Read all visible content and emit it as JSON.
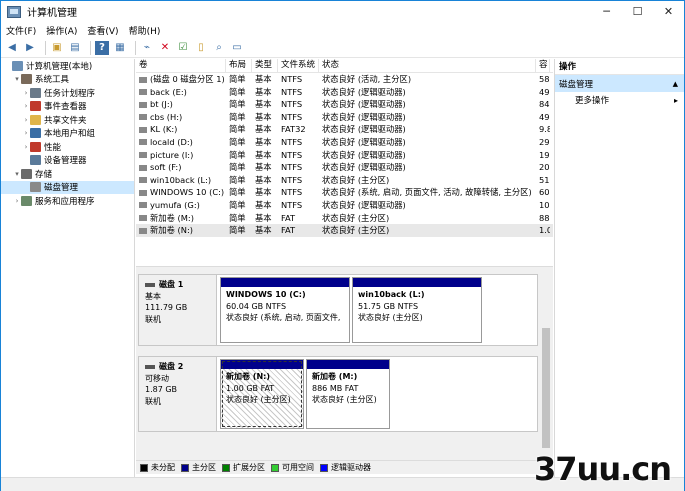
{
  "window": {
    "title": "计算机管理",
    "min": "─",
    "max": "☐",
    "close": "✕"
  },
  "menu": [
    "文件(F)",
    "操作(A)",
    "查看(V)",
    "帮助(H)"
  ],
  "tree": [
    {
      "label": "计算机管理(本地)",
      "indent": 0,
      "arrow": "",
      "color": "#6a8fb5"
    },
    {
      "label": "系统工具",
      "indent": 1,
      "arrow": "▾",
      "color": "#7a6a5a"
    },
    {
      "label": "任务计划程序",
      "indent": 2,
      "arrow": "›",
      "color": "#6a7a8a"
    },
    {
      "label": "事件查看器",
      "indent": 2,
      "arrow": "›",
      "color": "#c0392b"
    },
    {
      "label": "共享文件夹",
      "indent": 2,
      "arrow": "›",
      "color": "#e0b54a"
    },
    {
      "label": "本地用户和组",
      "indent": 2,
      "arrow": "›",
      "color": "#3a6ea5"
    },
    {
      "label": "性能",
      "indent": 2,
      "arrow": "›",
      "color": "#c0392b"
    },
    {
      "label": "设备管理器",
      "indent": 2,
      "arrow": "",
      "color": "#5a7a9a"
    },
    {
      "label": "存储",
      "indent": 1,
      "arrow": "▾",
      "color": "#6a6a6a"
    },
    {
      "label": "磁盘管理",
      "indent": 2,
      "arrow": "",
      "color": "#8a8a8a",
      "selected": true
    },
    {
      "label": "服务和应用程序",
      "indent": 1,
      "arrow": "›",
      "color": "#6a8a6a"
    }
  ],
  "columns": [
    "卷",
    "布局",
    "类型",
    "文件系统",
    "状态",
    "容"
  ],
  "volumes": [
    {
      "vol": "(磁盘 0 磁盘分区 1)",
      "layout": "简单",
      "type": "基本",
      "fs": "NTFS",
      "status": "状态良好 (活动, 主分区)",
      "cap": "58"
    },
    {
      "vol": "back (E:)",
      "layout": "简单",
      "type": "基本",
      "fs": "NTFS",
      "status": "状态良好 (逻辑驱动器)",
      "cap": "49"
    },
    {
      "vol": "bt (J:)",
      "layout": "简单",
      "type": "基本",
      "fs": "NTFS",
      "status": "状态良好 (逻辑驱动器)",
      "cap": "84"
    },
    {
      "vol": "cbs (H:)",
      "layout": "简单",
      "type": "基本",
      "fs": "NTFS",
      "status": "状态良好 (逻辑驱动器)",
      "cap": "49"
    },
    {
      "vol": "KL (K:)",
      "layout": "简单",
      "type": "基本",
      "fs": "FAT32",
      "status": "状态良好 (逻辑驱动器)",
      "cap": "9.8"
    },
    {
      "vol": "locald (D:)",
      "layout": "简单",
      "type": "基本",
      "fs": "NTFS",
      "status": "状态良好 (逻辑驱动器)",
      "cap": "29"
    },
    {
      "vol": "picture (I:)",
      "layout": "简单",
      "type": "基本",
      "fs": "NTFS",
      "status": "状态良好 (逻辑驱动器)",
      "cap": "19"
    },
    {
      "vol": "soft (F:)",
      "layout": "简单",
      "type": "基本",
      "fs": "NTFS",
      "status": "状态良好 (逻辑驱动器)",
      "cap": "20"
    },
    {
      "vol": "win10back (L:)",
      "layout": "简单",
      "type": "基本",
      "fs": "NTFS",
      "status": "状态良好 (主分区)",
      "cap": "51"
    },
    {
      "vol": "WINDOWS 10 (C:)",
      "layout": "简单",
      "type": "基本",
      "fs": "NTFS",
      "status": "状态良好 (系统, 启动, 页面文件, 活动, 故障转储, 主分区)",
      "cap": "60"
    },
    {
      "vol": "yumufa (G:)",
      "layout": "简单",
      "type": "基本",
      "fs": "NTFS",
      "status": "状态良好 (逻辑驱动器)",
      "cap": "10"
    },
    {
      "vol": "新加卷 (M:)",
      "layout": "简单",
      "type": "基本",
      "fs": "FAT",
      "status": "状态良好 (主分区)",
      "cap": "88"
    },
    {
      "vol": "新加卷 (N:)",
      "layout": "简单",
      "type": "基本",
      "fs": "FAT",
      "status": "状态良好 (主分区)",
      "cap": "1.0",
      "selected": true
    }
  ],
  "disks": [
    {
      "name": "磁盘 1",
      "kind": "基本",
      "size": "111.79 GB",
      "state": "联机",
      "parts": [
        {
          "name": "WINDOWS 10  (C:)",
          "size": "60.04 GB NTFS",
          "status": "状态良好 (系统, 启动, 页面文件,"
        },
        {
          "name": "win10back  (L:)",
          "size": "51.75 GB NTFS",
          "status": "状态良好 (主分区)"
        }
      ]
    },
    {
      "name": "磁盘 2",
      "kind": "可移动",
      "size": "1.87 GB",
      "state": "联机",
      "parts": [
        {
          "name": "新加卷  (N:)",
          "size": "1.00 GB FAT",
          "status": "状态良好 (主分区)"
        },
        {
          "name": "新加卷  (M:)",
          "size": "886 MB FAT",
          "status": "状态良好 (主分区)"
        }
      ]
    }
  ],
  "legend": [
    {
      "label": "未分配",
      "color": "#000000"
    },
    {
      "label": "主分区",
      "color": "#00008b"
    },
    {
      "label": "扩展分区",
      "color": "#008000"
    },
    {
      "label": "可用空间",
      "color": "#33cc33"
    },
    {
      "label": "逻辑驱动器",
      "color": "#0000ff"
    }
  ],
  "actions": {
    "header": "操作",
    "section": "磁盘管理",
    "section_arrow": "▲",
    "more": "更多操作",
    "more_arrow": "▸"
  },
  "watermark": "37uu.cn"
}
